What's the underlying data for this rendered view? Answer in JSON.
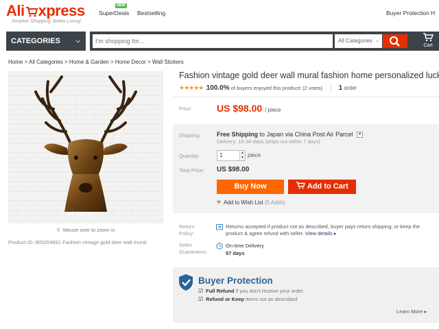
{
  "header": {
    "logo_ali": "Ali",
    "logo_express": "xpress",
    "tagline": "Smarter Shopping, Better Living!",
    "nav": {
      "superdeals": "SuperDeals",
      "new_badge": "NEW",
      "bestselling": "Bestselling"
    },
    "buyer_protection": "Buyer Protection",
    "help": "H"
  },
  "search": {
    "categories_label": "CATEGORIES",
    "placeholder": "I'm shopping for...",
    "scope": "All Categories",
    "cart_label": "Cart"
  },
  "breadcrumb": "Home > All Categories > Home & Garden > Home Decor > Wall Stickers",
  "product": {
    "title": "Fashion vintage gold deer wall mural fashion home personalized lucky wall",
    "stars": "★★★★★",
    "rating_pct": "100.0%",
    "rating_text": "of buyers enjoyed this product! (2 votes)",
    "orders_count": "1",
    "orders_label": "order",
    "zoom_hint": "Mouse over to zoom in",
    "product_id": "Product ID: 805204691 Fashion vintage gold deer wall mural",
    "watermark": "天秘家居饰品店"
  },
  "price": {
    "label": "Price:",
    "value": "US $98.00",
    "unit": "/ piece"
  },
  "shipping": {
    "label": "Shipping:",
    "free": "Free Shipping",
    "to": "to",
    "destination": "Japan via China Post Air Parcel",
    "delivery": "Delivery: 15-34 days (ships out within 7 days)"
  },
  "quantity": {
    "label": "Quantity:",
    "value": "1",
    "unit": "piece"
  },
  "total": {
    "label": "Total Price:",
    "value": "US $98.00"
  },
  "actions": {
    "buy_now": "Buy Now",
    "add_to_cart": "Add to Cart",
    "wishlist": "Add to Wish List",
    "wishlist_count": "(5 Adds)"
  },
  "return_policy": {
    "label_1": "Return",
    "label_2": "Policy:",
    "text": "Returns accepted if product not as described, buyer pays return shipping; or keep the product & agree refund with seller.",
    "link": "View details"
  },
  "seller_guarantees": {
    "label_1": "Seller",
    "label_2": "Guarantees:",
    "on_time": "On-time Delivery",
    "days": "57 days"
  },
  "buyer_protection": {
    "title": "Buyer Protection",
    "item1_bold": "Full Refund",
    "item1_rest": "if you don't receive your order",
    "item2_bold": "Refund or Keep",
    "item2_rest": "items not as described",
    "learn_more": "Learn More"
  },
  "colors": {
    "brand_red": "#e62e04",
    "buy_orange": "#ff6600",
    "dark_bar": "#3d4449",
    "bp_blue": "#2a6496"
  }
}
